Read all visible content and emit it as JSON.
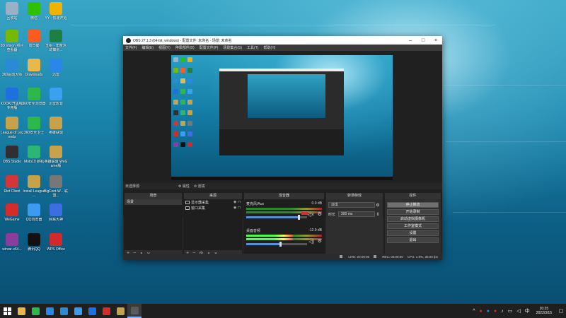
{
  "desktop": {
    "icons": [
      {
        "label": "回收站",
        "icon": "recycle-bin-icon",
        "color": "#9ab0c4"
      },
      {
        "label": "微信",
        "icon": "wechat-icon",
        "color": "#2dc100"
      },
      {
        "label": "YY - 快速开始",
        "icon": "yy-icon",
        "color": "#f0b400"
      },
      {
        "label": "3D Vision 照片查看器",
        "icon": "3d-vision-icon",
        "color": "#76b900"
      },
      {
        "label": "向日葵",
        "icon": "sunflower-remote-icon",
        "color": "#ff5a1f"
      },
      {
        "label": "五组 - 年度活动策划...",
        "icon": "excel-file-icon",
        "color": "#1d7f45"
      },
      {
        "label": "360驱动大师",
        "icon": "driver-master-icon",
        "color": "#2a8ad6"
      },
      {
        "label": "Downloads",
        "icon": "folder-icon",
        "color": "#e8b84a"
      },
      {
        "label": "迅雷",
        "icon": "thunder-icon",
        "color": "#2a86e8"
      },
      {
        "label": "KOOK(开黑啦)专用版",
        "icon": "kook-icon",
        "color": "#1e6fdf"
      },
      {
        "label": "360安全浏览器",
        "icon": "360-browser-icon",
        "color": "#2eb84b"
      },
      {
        "label": "迅雷影音",
        "icon": "thunder-player-icon",
        "color": "#3aa0f0"
      },
      {
        "label": "League of Legends",
        "icon": "lol-icon",
        "color": "#c7a24a"
      },
      {
        "label": "360安全卫士",
        "icon": "360-guard-icon",
        "color": "#2eb84b"
      },
      {
        "label": "英雄联盟",
        "icon": "lol-cn-icon",
        "color": "#c7a24a"
      },
      {
        "label": "OBS Studio",
        "icon": "obs-icon",
        "color": "#302e31"
      },
      {
        "label": "Moto10 刷机",
        "icon": "tool-icon",
        "color": "#2bb673"
      },
      {
        "label": "英雄联盟 WeGame版",
        "icon": "lol-wegame-icon",
        "color": "#c7a24a"
      },
      {
        "label": "Riot Client",
        "icon": "riot-icon",
        "color": "#d13639"
      },
      {
        "label": "Install League ...",
        "icon": "lol-install-icon",
        "color": "#c7a24a"
      },
      {
        "label": "BigFoot-W... 联盟...",
        "icon": "bigfoot-icon",
        "color": "#777777"
      },
      {
        "label": "WeGame",
        "icon": "wegame-icon",
        "color": "#d42b2b"
      },
      {
        "label": "QQ浏览器",
        "icon": "qq-browser-icon",
        "color": "#3a9bf0"
      },
      {
        "label": "网易大神",
        "icon": "netease-icon",
        "color": "#3d6de0"
      },
      {
        "label": "winrar-x64...",
        "icon": "winrar-icon",
        "color": "#8a3d9c"
      },
      {
        "label": "腾讯QQ",
        "icon": "qq-icon",
        "color": "#111111"
      },
      {
        "label": "WPS Office",
        "icon": "wps-icon",
        "color": "#d12a2a"
      }
    ]
  },
  "obs": {
    "title": "OBS 27.1.3 (64-bit, windows) - 配置文件: 未命名 - 场景: 未命名",
    "menu": [
      "文件(F)",
      "编辑(E)",
      "视图(V)",
      "停靠部件(D)",
      "配置文件(P)",
      "场景集合(S)",
      "工具(T)",
      "帮助(H)"
    ],
    "dock_header": {
      "no_source": "未选择源",
      "props": "属性",
      "filters": "滤镜"
    },
    "scenes": {
      "title": "场景",
      "items": [
        "场景"
      ]
    },
    "sources": {
      "title": "来源",
      "items": [
        {
          "name": "显示器采集",
          "type": "monitor-icon"
        },
        {
          "name": "窗口采集",
          "type": "window-icon"
        }
      ]
    },
    "mixer": {
      "title": "混音器",
      "channels": [
        {
          "name": "麦克风/Aux",
          "db": "0.0 dB",
          "level": 0.0,
          "fader": 0.85,
          "muted": true
        },
        {
          "name": "桌面音频",
          "db": "-12.9 dB",
          "level": 0.62,
          "fader": 0.55,
          "muted": false
        }
      ]
    },
    "transitions": {
      "title": "转场特效",
      "type": "淡出",
      "duration_label": "时长",
      "duration_value": "300 ms"
    },
    "controls": {
      "title": "控件",
      "buttons": [
        "停止推流",
        "开始录制",
        "启动虚拟摄像机",
        "工作室模式",
        "设置",
        "退出"
      ]
    },
    "status": {
      "live": "LIVE: 00:00:00",
      "rec": "REC: 00:00:00",
      "cpu": "CPU: 1.9%, 30.00 fps"
    }
  },
  "taskbar": {
    "apps": [
      {
        "icon": "file-explorer-icon",
        "color": "#e8b84a"
      },
      {
        "icon": "360-browser-icon",
        "color": "#2eb84b"
      },
      {
        "icon": "thunder-icon",
        "color": "#2a86e8"
      },
      {
        "icon": "360-driver-icon",
        "color": "#2a8ad6"
      },
      {
        "icon": "qq-browser-icon",
        "color": "#3a9bf0"
      },
      {
        "icon": "kook-icon",
        "color": "#1e6fdf"
      },
      {
        "icon": "wegame-icon",
        "color": "#d42b2b"
      },
      {
        "icon": "lol-icon",
        "color": "#c7a24a"
      },
      {
        "icon": "obs-icon",
        "color": "#5a5a5a"
      }
    ],
    "time": "20:25",
    "date": "2022/3/15",
    "ime": "中"
  }
}
